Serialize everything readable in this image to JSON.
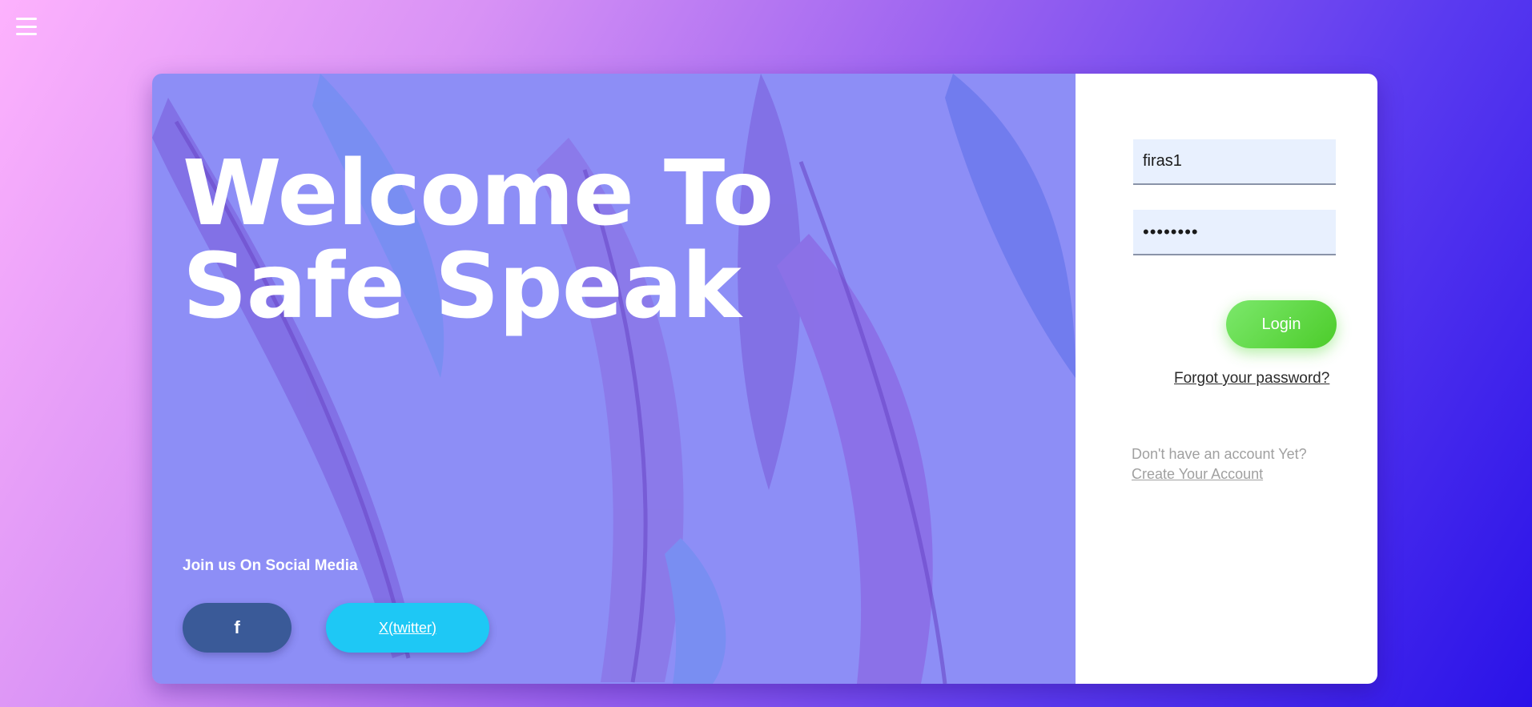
{
  "nav": {
    "menu_icon": "hamburger-menu-icon"
  },
  "hero": {
    "title": "Welcome To\nSafe Speak",
    "social_label": "Join us On Social Media",
    "facebook": {
      "label": "f",
      "icon": "facebook-icon",
      "color": "#3a5a98"
    },
    "twitter": {
      "label": "X(twitter)",
      "color": "#1ec8f5"
    }
  },
  "login": {
    "username_value": "firas1",
    "password_value": "••••••••",
    "login_label": "Login",
    "forgot_label": "Forgot your password?",
    "no_account_text": "Don't have an account Yet?",
    "create_account_label": "Create Your Account",
    "accent_color": "#5dd43e"
  }
}
